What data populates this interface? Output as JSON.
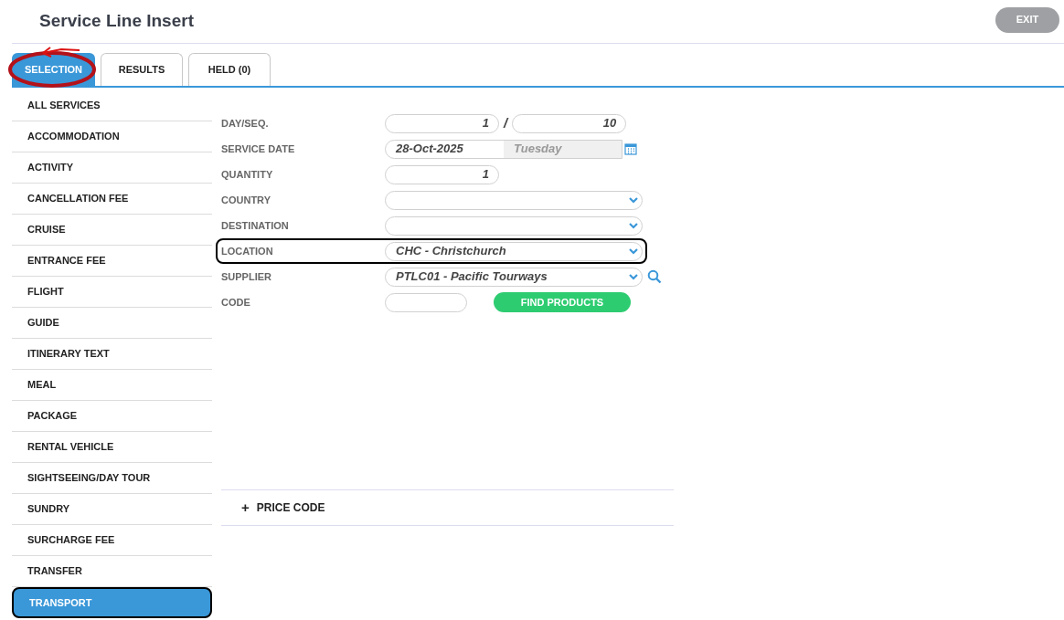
{
  "title": "Service Line Insert",
  "exit_button": "EXIT",
  "tabs": [
    {
      "label": "SELECTION",
      "selected": true,
      "circled": true
    },
    {
      "label": "RESULTS",
      "selected": false,
      "circled": false
    },
    {
      "label": "HELD (0)",
      "selected": false,
      "circled": false
    }
  ],
  "sidebar": {
    "items": [
      {
        "label": "ALL SERVICES",
        "selected": false,
        "outlined": false
      },
      {
        "label": "ACCOMMODATION",
        "selected": false,
        "outlined": false
      },
      {
        "label": "ACTIVITY",
        "selected": false,
        "outlined": false
      },
      {
        "label": "CANCELLATION FEE",
        "selected": false,
        "outlined": false
      },
      {
        "label": "CRUISE",
        "selected": false,
        "outlined": false
      },
      {
        "label": "ENTRANCE FEE",
        "selected": false,
        "outlined": false
      },
      {
        "label": "FLIGHT",
        "selected": false,
        "outlined": false
      },
      {
        "label": "GUIDE",
        "selected": false,
        "outlined": false
      },
      {
        "label": "ITINERARY TEXT",
        "selected": false,
        "outlined": false
      },
      {
        "label": "MEAL",
        "selected": false,
        "outlined": false
      },
      {
        "label": "PACKAGE",
        "selected": false,
        "outlined": false
      },
      {
        "label": "RENTAL VEHICLE",
        "selected": false,
        "outlined": false
      },
      {
        "label": "SIGHTSEEING/DAY TOUR",
        "selected": false,
        "outlined": false
      },
      {
        "label": "SUNDRY",
        "selected": false,
        "outlined": false
      },
      {
        "label": "SURCHARGE FEE",
        "selected": false,
        "outlined": false
      },
      {
        "label": "TRANSFER",
        "selected": false,
        "outlined": false
      },
      {
        "label": "TRANSPORT",
        "selected": true,
        "outlined": true
      }
    ]
  },
  "form": [
    {
      "kind": "dayseq",
      "label": "DAY/SEQ.",
      "value": "1",
      "separator": "/",
      "value_2": "10",
      "outlined": false
    },
    {
      "kind": "date",
      "label": "SERVICE DATE",
      "value": "28-Oct-2025",
      "weekday": "Tuesday",
      "outlined": false
    },
    {
      "kind": "number",
      "label": "QUANTITY",
      "value": "1",
      "outlined": false
    },
    {
      "kind": "select",
      "label": "COUNTRY",
      "outlined": false
    },
    {
      "kind": "select",
      "label": "DESTINATION",
      "outlined": false
    },
    {
      "kind": "select",
      "label": "LOCATION",
      "value": "CHC - Christchurch",
      "outlined": true
    },
    {
      "kind": "supplier",
      "label": "SUPPLIER",
      "value": "PTLC01 - Pacific Tourways",
      "outlined": false
    },
    {
      "kind": "code",
      "label": "CODE",
      "button": "FIND PRODUCTS",
      "outlined": false
    }
  ],
  "price_code": {
    "icon": "+",
    "label": "PRICE CODE"
  }
}
